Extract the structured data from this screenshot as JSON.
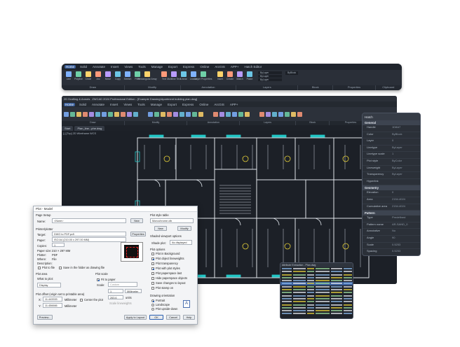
{
  "ribbon": {
    "tabs": [
      "Home",
      "Solid",
      "Annotate",
      "Insert",
      "Views",
      "Tools",
      "Manage",
      "Export",
      "Express",
      "Online",
      "ArcGIS",
      "APP+",
      "Hatch Editor"
    ],
    "active_tab": "Home",
    "tools": [
      "Line",
      "Polyline",
      "Circle",
      "Arc",
      "Move",
      "Copy",
      "Stretch",
      "Fillet",
      "Rectangular Array",
      "Text",
      "Multiline Text",
      "Linear",
      "Leader",
      "Layer Properties",
      "Insert",
      "Create",
      "Match",
      "Paste"
    ],
    "layer_values": [
      "ByLayer",
      "ByLayer",
      "ByLayer"
    ],
    "block_value": "ByBlock",
    "groups": [
      "Draw",
      "Modify",
      "Annotation",
      "Layers",
      "Block",
      "Properties",
      "Clipboard"
    ]
  },
  "main_window": {
    "title": "2D Drafting & Annots",
    "doc_title": "ZWCAD 2024 Professional Edition - [Example Drawing\\Apartment building plan.dwg]",
    "tabs": [
      "Home",
      "Solid",
      "Annotate",
      "Insert",
      "Views",
      "Tools",
      "Manage",
      "Export",
      "Express",
      "Online",
      "ArcGIS",
      "APP+"
    ],
    "groups": [
      "Draw",
      "Modify",
      "Annotation",
      "Layers",
      "Block",
      "Properties",
      "Clipboard"
    ],
    "doc_tabs": [
      "Start",
      "Plan_line...phe.dwg"
    ],
    "viewport_label": "[-] [Top] 2D Wireframe WCS"
  },
  "properties": {
    "header": "Hatch",
    "sections": [
      {
        "title": "General",
        "rows": [
          [
            "Handle",
            "1D8A7"
          ],
          [
            "Color",
            "ByBlock"
          ],
          [
            "Layer",
            "0"
          ],
          [
            "Linetype",
            "ByLayer"
          ],
          [
            "Linetype scale",
            "1"
          ],
          [
            "Plot style",
            "ByColor"
          ],
          [
            "Lineweight",
            "ByLayer"
          ],
          [
            "Transparency",
            "ByLayer"
          ],
          [
            "Hyperlink",
            ""
          ]
        ]
      },
      {
        "title": "Geometry",
        "rows": [
          [
            "Elevation",
            "0"
          ],
          [
            "Area",
            "2154.4024"
          ],
          [
            "Cumulative area",
            "2154.4024"
          ]
        ]
      },
      {
        "title": "Pattern",
        "rows": [
          [
            "Type",
            "Predefined"
          ],
          [
            "Pattern name",
            "AR-SAND_0"
          ],
          [
            "Annotative",
            "No"
          ],
          [
            "Angle",
            "90"
          ],
          [
            "Scale",
            "0.5253"
          ],
          [
            "Spacing",
            "0.5253"
          ]
        ]
      }
    ]
  },
  "plot_dialog": {
    "title": "Plot - Model",
    "page_setup_label": "Page Setup",
    "name_label": "Name:",
    "name_value": "<None>",
    "add_btn": "New",
    "printer_label": "Printer/plotter",
    "target_label": "Target:",
    "target_value": "DWG to PDF.pc5",
    "properties_btn": "Properties",
    "paper_label": "Paper:",
    "paper_value": "ISO A4 (210.00 x 297.00 MM)",
    "copies_label": "Copies:",
    "copies_value": "1",
    "papersize_label": "Paper size:",
    "papersize_value": "210 × 297   MM",
    "plotter_label": "Plotter:",
    "plotter_value": "PDF",
    "where_label": "Where:",
    "where_value": "File",
    "description_label": "Description:",
    "plot_to_file": "Plot to file",
    "save_pdf": "Save in the folder as drawing file",
    "plot_area_label": "Plot area",
    "what_to_plot": "What to plot:",
    "what_value": "Display",
    "plot_offset_label": "Plot offset (origin set to printable area)",
    "x_label": "X:",
    "x_value": "11.443333",
    "x_unit": "Millimeter",
    "center_plot": "Center the plot",
    "y_label": "Y:",
    "y_value": "11.456666",
    "y_unit": "Millimeter",
    "plot_scale_label": "Plot scale",
    "fit_paper": "Fit to paper",
    "scale_label": "Scale:",
    "scale_value": "Custom",
    "scale_num": "1",
    "scale_unit": "Millimeter",
    "scale_den": "263.6",
    "scale_units": "units",
    "scale_lw": "Scale lineweights",
    "pst_label": "Plot style table",
    "pst_value": "Monochrome.ctb",
    "new_btn": "New",
    "modify_btn": "Modify",
    "svo_label": "Shaded viewport options",
    "shade_label": "Shade plot:",
    "shade_value": "As displayed",
    "plot_options_label": "Plot options",
    "opts": [
      "Plot in Background",
      "Plot object lineweights",
      "Plot transparency",
      "Plot with plot styles",
      "Plot paperspace last",
      "Hide paperspace objects",
      "Save changes to layout",
      "Plot stamp on"
    ],
    "opts_on": [
      false,
      true,
      false,
      true,
      false,
      false,
      false,
      false
    ],
    "orient_label": "Drawing orientation",
    "orients": [
      "Portrait",
      "Landscape",
      "Plot upside-down"
    ],
    "preview_btn": "Preview...",
    "apply_btn": "Apply to Layout",
    "ok_btn": "OK",
    "cancel_btn": "Cancel",
    "help_btn": "Help"
  },
  "table_window": {
    "title": "Attribute Extraction - Plan.dwg"
  },
  "colors": {
    "accent": "#3b5f9a",
    "cad_bg": "#1c2027",
    "wall": "#e8edf2",
    "cyan": "#22c6c6",
    "yellow": "#e8d23a"
  }
}
